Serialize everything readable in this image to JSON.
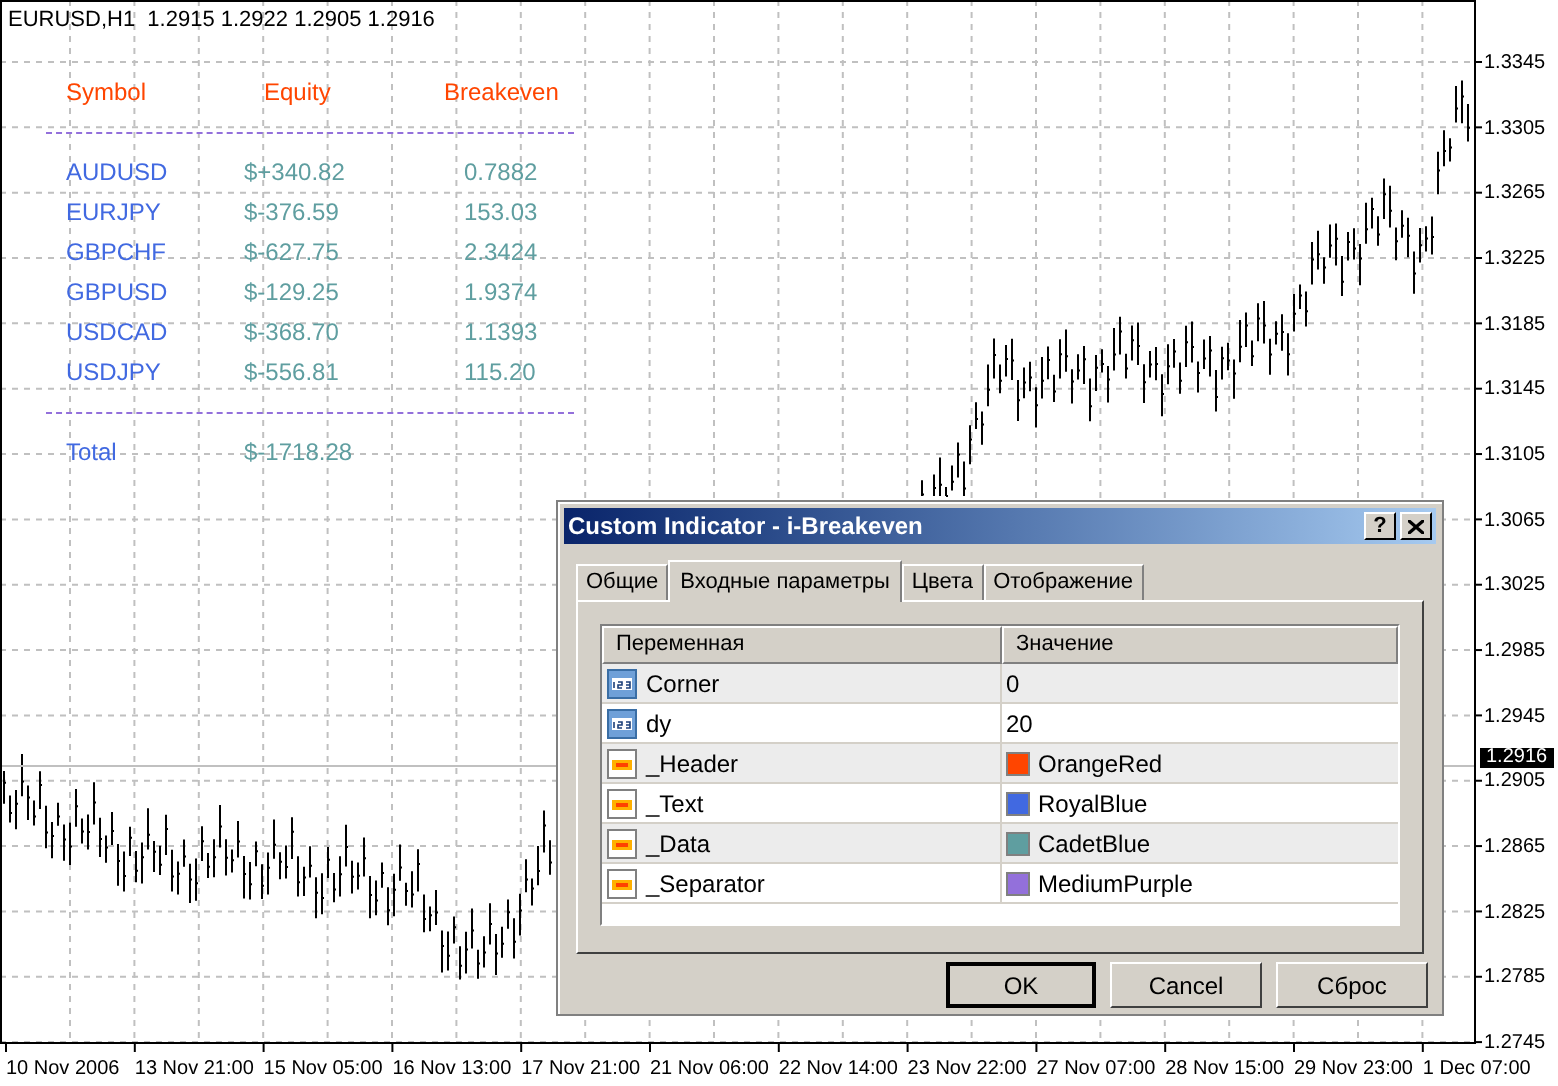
{
  "chart_header": "EURUSD,H1  1.2915 1.2922 1.2905 1.2916",
  "overlay": {
    "columns": [
      "Symbol",
      "Equity",
      "Breakeven"
    ],
    "rows": [
      {
        "symbol": "AUDUSD",
        "equity": "$+340.82",
        "breakeven": "0.7882"
      },
      {
        "symbol": "EURJPY",
        "equity": "$-376.59",
        "breakeven": "153.03"
      },
      {
        "symbol": "GBPCHF",
        "equity": "$-627.75",
        "breakeven": "2.3424"
      },
      {
        "symbol": "GBPUSD",
        "equity": "$-129.25",
        "breakeven": "1.9374"
      },
      {
        "symbol": "USDCAD",
        "equity": "$-368.70",
        "breakeven": "1.1393"
      },
      {
        "symbol": "USDJPY",
        "equity": "$-556.81",
        "breakeven": "115.20"
      }
    ],
    "total": {
      "label": "Total",
      "equity": "$-1718.28"
    }
  },
  "price_axis": [
    "1.3345",
    "1.3305",
    "1.3265",
    "1.3225",
    "1.3185",
    "1.3145",
    "1.3105",
    "1.3065",
    "1.3025",
    "1.2985",
    "1.2945",
    "1.2905",
    "1.2865",
    "1.2825",
    "1.2785",
    "1.2745"
  ],
  "current_price": "1.2916",
  "time_axis": [
    "10 Nov 2006",
    "13 Nov 21:00",
    "15 Nov 05:00",
    "16 Nov 13:00",
    "17 Nov 21:00",
    "21 Nov 06:00",
    "22 Nov 14:00",
    "23 Nov 22:00",
    "27 Nov 07:00",
    "28 Nov 15:00",
    "29 Nov 23:00",
    "1 Dec 07:00"
  ],
  "dialog": {
    "title": "Custom Indicator - i-Breakeven",
    "help_button": "?",
    "tabs": [
      {
        "label": "Общие",
        "selected": false
      },
      {
        "label": "Входные параметры",
        "selected": true
      },
      {
        "label": "Цвета",
        "selected": false
      },
      {
        "label": "Отображение",
        "selected": false
      }
    ],
    "table": {
      "columns": [
        "Переменная",
        "Значение"
      ],
      "rows": [
        {
          "kind": "number",
          "name": "Corner",
          "value": "0"
        },
        {
          "kind": "number",
          "name": "dy",
          "value": "20"
        },
        {
          "kind": "color",
          "name": "_Header",
          "value": "OrangeRed",
          "color": "#ff4500"
        },
        {
          "kind": "color",
          "name": "_Text",
          "value": "RoyalBlue",
          "color": "#4169e1"
        },
        {
          "kind": "color",
          "name": "_Data",
          "value": "CadetBlue",
          "color": "#5f9ea0"
        },
        {
          "kind": "color",
          "name": "_Separator",
          "value": "MediumPurple",
          "color": "#9370db"
        }
      ]
    },
    "buttons": [
      {
        "label": "OK",
        "default": true
      },
      {
        "label": "Cancel",
        "default": false
      },
      {
        "label": "Сброс",
        "default": false
      }
    ]
  }
}
